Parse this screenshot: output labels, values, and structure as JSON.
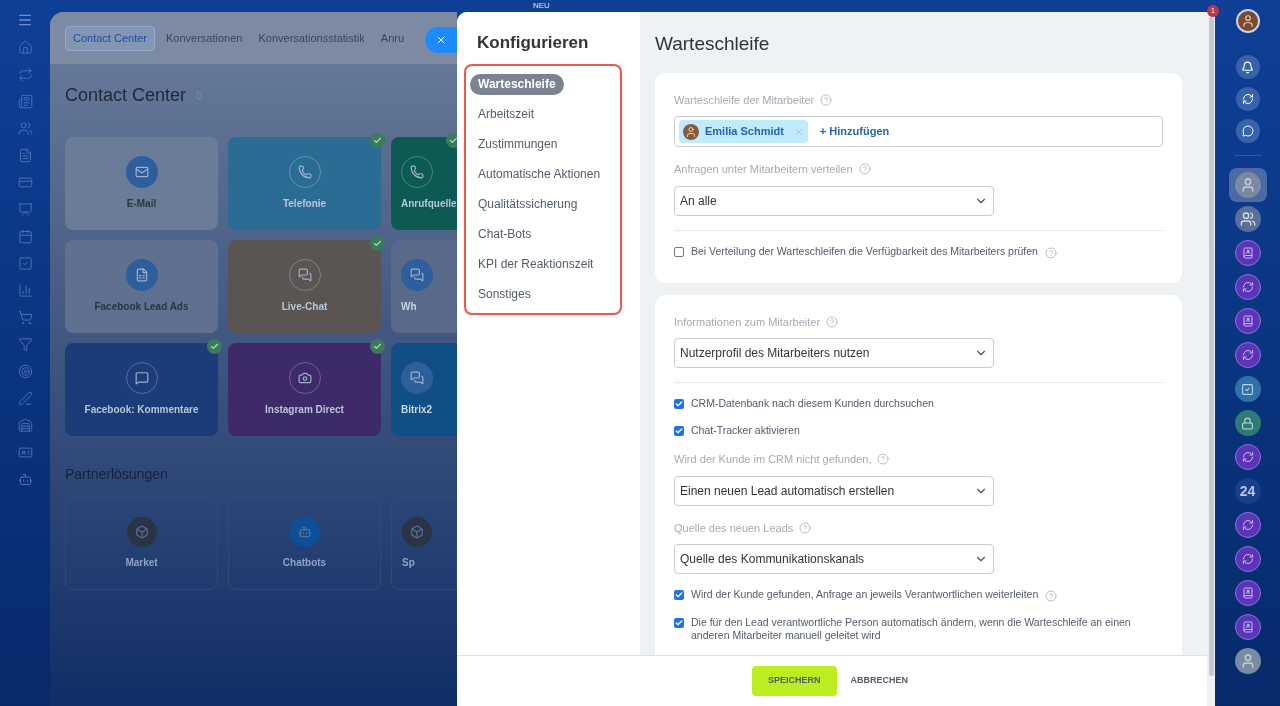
{
  "top_badge": "NEU",
  "background": {
    "tabs": [
      {
        "label": "Contact Center",
        "selected": true
      },
      {
        "label": "Konversationen",
        "selected": false
      },
      {
        "label": "Konversationsstatistik",
        "selected": false
      },
      {
        "label": "Anru",
        "selected": false
      }
    ],
    "title": "Contact Center",
    "connectors": [
      {
        "label": "E-Mail",
        "color": "#6b7c98",
        "connected": false,
        "kind": "mail"
      },
      {
        "label": "Telefonie",
        "color": "#2a6c93",
        "connected": true,
        "kind": "phone"
      },
      {
        "label": "Anrufquelle",
        "color": "#0c5a52",
        "connected": true,
        "kind": "phone"
      },
      {
        "label": "Facebook Lead Ads",
        "color": "#5f7090",
        "connected": false,
        "kind": "form"
      },
      {
        "label": "Live-Chat",
        "color": "#5a5552",
        "connected": true,
        "kind": "chat"
      },
      {
        "label": "Wh",
        "color": "#58698a",
        "connected": false,
        "kind": "chat"
      },
      {
        "label": "Facebook: Kommentare",
        "color": "#1b3c78",
        "connected": true,
        "kind": "comment"
      },
      {
        "label": "Instagram Direct",
        "color": "#3e2a68",
        "connected": true,
        "kind": "camera"
      },
      {
        "label": "Bitrix2",
        "color": "#0f4f85",
        "connected": false,
        "kind": "chat"
      }
    ],
    "partners_title": "Partnerlösungen",
    "partners": [
      {
        "label": "Market",
        "kind": "box"
      },
      {
        "label": "Chatbots",
        "kind": "bot"
      },
      {
        "label": "Sp",
        "kind": "box"
      }
    ]
  },
  "panel": {
    "title": "Konfigurieren",
    "nav": [
      {
        "label": "Warteschleife",
        "selected": true
      },
      {
        "label": "Arbeitszeit",
        "selected": false
      },
      {
        "label": "Zustimmungen",
        "selected": false
      },
      {
        "label": "Automatische Aktionen",
        "selected": false
      },
      {
        "label": "Qualitätssicherung",
        "selected": false
      },
      {
        "label": "Chat-Bots",
        "selected": false
      },
      {
        "label": "KPI der Reaktionszeit",
        "selected": false
      },
      {
        "label": "Sonstiges",
        "selected": false
      }
    ],
    "heading": "Warteschleife",
    "sections": [
      {
        "fields": [
          {
            "kind": "users",
            "label": "Warteschleife der Mitarbeiter",
            "help": true,
            "users": [
              {
                "name": "Emilia Schmidt"
              }
            ],
            "add": "+ Hinzufügen"
          },
          {
            "kind": "select",
            "label": "Anfragen unter Mitarbeitern verteilen",
            "help": true,
            "value": "An alle"
          },
          {
            "kind": "divider"
          },
          {
            "kind": "checkbox",
            "label": "Bei Verteilung der Warteschleifen die Verfügbarkeit des Mitarbeiters prüfen",
            "help": true,
            "checked": false
          }
        ]
      },
      {
        "fields": [
          {
            "kind": "select",
            "label": "Informationen zum Mitarbeiter",
            "help": true,
            "value": "Nutzerprofil des Mitarbeiters nutzen"
          },
          {
            "kind": "divider"
          },
          {
            "kind": "checkbox",
            "label": "CRM-Datenbank nach diesem Kunden durchsuchen",
            "help": false,
            "checked": true
          },
          {
            "kind": "checkbox",
            "label": "Chat-Tracker aktivieren",
            "help": false,
            "checked": true
          },
          {
            "kind": "select",
            "label": "Wird der Kunde im CRM nicht gefunden,",
            "help": true,
            "value": "Einen neuen Lead automatisch erstellen"
          },
          {
            "kind": "select",
            "label": "Quelle des neuen Leads",
            "help": true,
            "value": "Quelle des Kommunikationskanals"
          },
          {
            "kind": "checkbox",
            "label": "Wird der Kunde gefunden, Anfrage an jeweils Verantwortlichen weiterleiten",
            "help": true,
            "checked": true
          },
          {
            "kind": "checkbox",
            "label": "Die für den Lead verantwortliche Person automatisch ändern, wenn die Warteschleife an einen anderen Mitarbeiter manuell geleitet wird",
            "help": false,
            "checked": true
          }
        ]
      }
    ],
    "save": "SPEICHERN",
    "cancel": "ABBRECHEN"
  },
  "right_rail": {
    "badge": "1",
    "items": [
      {
        "kind": "avatar",
        "selected": true
      },
      {
        "kind": "group",
        "selected": false
      },
      {
        "kind": "contact",
        "selected": false
      },
      {
        "kind": "openline",
        "selected": false
      },
      {
        "kind": "contact",
        "selected": false
      },
      {
        "kind": "openline",
        "selected": false
      },
      {
        "kind": "task",
        "selected": false
      },
      {
        "kind": "lock",
        "selected": false
      },
      {
        "kind": "openline",
        "selected": false
      },
      {
        "kind": "text",
        "text": "24",
        "selected": false
      },
      {
        "kind": "openline",
        "selected": false
      },
      {
        "kind": "openline",
        "selected": false
      },
      {
        "kind": "contact",
        "selected": false
      },
      {
        "kind": "contact",
        "selected": false
      },
      {
        "kind": "avatar",
        "selected": false
      }
    ]
  }
}
